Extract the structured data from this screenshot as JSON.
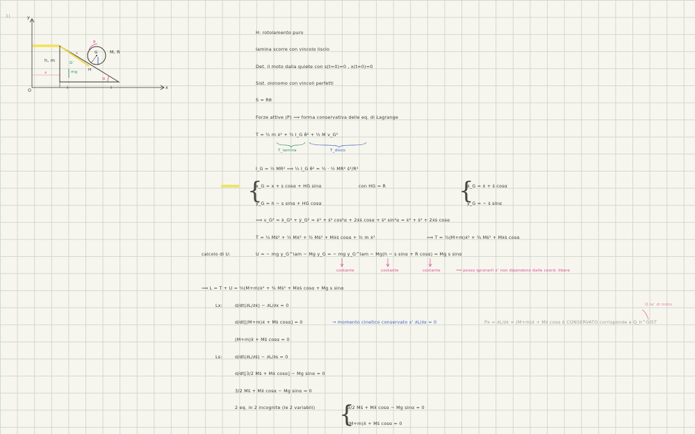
{
  "problem_number": "1)",
  "diagram": {
    "axis_y": "y",
    "axis_x": "x",
    "origin": "O",
    "slope_label": "h, m",
    "disk_label": "M, R",
    "theta": "θ",
    "g_label": "G",
    "h_point": "H",
    "g1_label": "G'",
    "weight_label": "mg",
    "s_label": "s",
    "x_label": "x",
    "alpha_label": "α",
    "accent_pink": "#d9458f",
    "accent_green": "#2e8f5a",
    "accent_blue": "#3a5bbf"
  },
  "lines": {
    "l1": "H: rotolamento puro",
    "l2": "lamina scorre con vincolo liscio",
    "l3": "Det. il moto dalla quiete con s(t=0)=0 , x(t=0)=0",
    "l4": "Sist. olonomo con vincoli perfetti",
    "l5": "S = Rθ",
    "l6": "Forze attive (P) ⟹ forma conservativa delle eq. di Lagrange",
    "l7": "T = ½ m ẋ² + ½ I_G θ̇² + ½ M v_G²",
    "l7a": "T_lamina",
    "l7b": "T_disco",
    "l8": "I_G = ½ MR² ⟹ ½ I_G θ̇² = ½ · ½ MR² ṡ²/R²",
    "sys1a": "x_G = x + s cosα + HG sinα",
    "sys1b": "y_G = h − s sinα + HG cosα",
    "sys1c": "con HG = R",
    "sys2a": "ẋ_G = ẋ + ṡ cosα",
    "sys2b": "ẏ_G = − ṡ sinα",
    "l9": "⟹ v_G² = ẋ_G² + ẏ_G² = ẋ² + ṡ² cos²α + 2ẋṡ cosα + ṡ² sin²α = ẋ² + ṡ² + 2ẋṡ cosα",
    "l10": "T = ¼ Mṡ² + ½ Mẋ² + ½ Mṡ² + Mẋṡ cosα + ½ m ẋ²",
    "l10b": "⟹ T = ½(M+m)ẋ² + ¾ Mṡ² + Mẋṡ cosα",
    "calc_label": "calcolo di U:",
    "l11": "U = − mg y_G^lam − Mg y_G = − mg y_G^lam − Mg(h − s sinα + R cosα) = Mg s sinα",
    "const1": "costante",
    "const2": "costante",
    "const3": "costante",
    "const_note": "⟹ posso ignorarli x' non dipendono dalle coord. libere",
    "l12": "⟹ L = T + U = ½(M+m)ẋ² + ¾ Mṡ² + Mẋṡ cosα + Mg s sinα",
    "lx_label": "Lx:",
    "lx1": "d/dt(∂L/∂ẋ) − ∂L/∂x = 0",
    "lx2": "d/dt[(M+m)ẋ + Mṡ cosα] = 0",
    "lx2_note": "→ momento cinetico conservato x' ∂L/∂x = 0",
    "px_note": "Px = ∂L/∂ẋ = (M+m)ẋ + Mṡ cosα   è CONSERVATO corrisponde a Q_h^GIST",
    "px_side": "Q.ta' di moto",
    "lx3": "(M+m)ẍ + Ms̈ cosα = 0",
    "ls_label": "Ls:",
    "ls1": "d/dt(∂L/∂ṡ) − ∂L/∂s = 0",
    "ls2": "d/dt[3/2 Mṡ + Mẋ cosα] − Mg sinα = 0",
    "ls3": "3/2 Ms̈ + Mẍ cosα − Mg sinα = 0",
    "ls4": "2 eq. in 2 incognite (le 2 variabili)",
    "sys3a": "3/2 Ms̈ + Mẍ cosα − Mg sinα = 0",
    "sys3b": "(M+m)ẍ + Ms̈ cosα = 0"
  }
}
